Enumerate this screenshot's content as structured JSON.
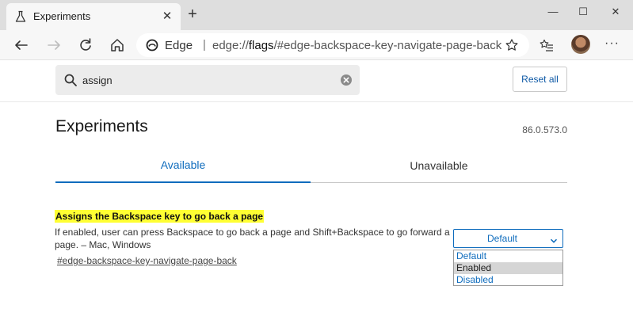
{
  "browser": {
    "tab_title": "Experiments",
    "tab_close_glyph": "✕",
    "new_tab_glyph": "+",
    "omnibox_label": "Edge",
    "omnibox_separator": "|",
    "url_prefix": "edge://",
    "url_bold": "flags",
    "url_suffix": "/#edge-backspace-key-navigate-page-back",
    "more_glyph": "···",
    "window_controls": {
      "minimize": "—",
      "maximize": "☐",
      "close": "✕"
    },
    "icons": [
      "flask-icon",
      "back-icon",
      "forward-icon",
      "refresh-icon",
      "home-icon",
      "edge-logo-icon",
      "star-icon",
      "favorites-icon",
      "avatar",
      "more-icon"
    ]
  },
  "search": {
    "value": "assign",
    "reset_label": "Reset all"
  },
  "page": {
    "title": "Experiments",
    "version": "86.0.573.0",
    "tabs": [
      {
        "label": "Available",
        "active": true
      },
      {
        "label": "Unavailable",
        "active": false
      }
    ]
  },
  "flag": {
    "title": "Assigns the Backspace key to go back a page",
    "description": "If enabled, user can press Backspace to go back a page and Shift+Backspace to go forward a page. – Mac, Windows",
    "link": "#edge-backspace-key-navigate-page-back",
    "selected": "Default",
    "options": [
      "Default",
      "Enabled",
      "Disabled"
    ],
    "highlighted_option": "Enabled"
  },
  "colors": {
    "accent": "#0f6cbd",
    "highlight": "#ffff33",
    "titlebar": "#dedede",
    "toolbar": "#f7f7f7"
  }
}
